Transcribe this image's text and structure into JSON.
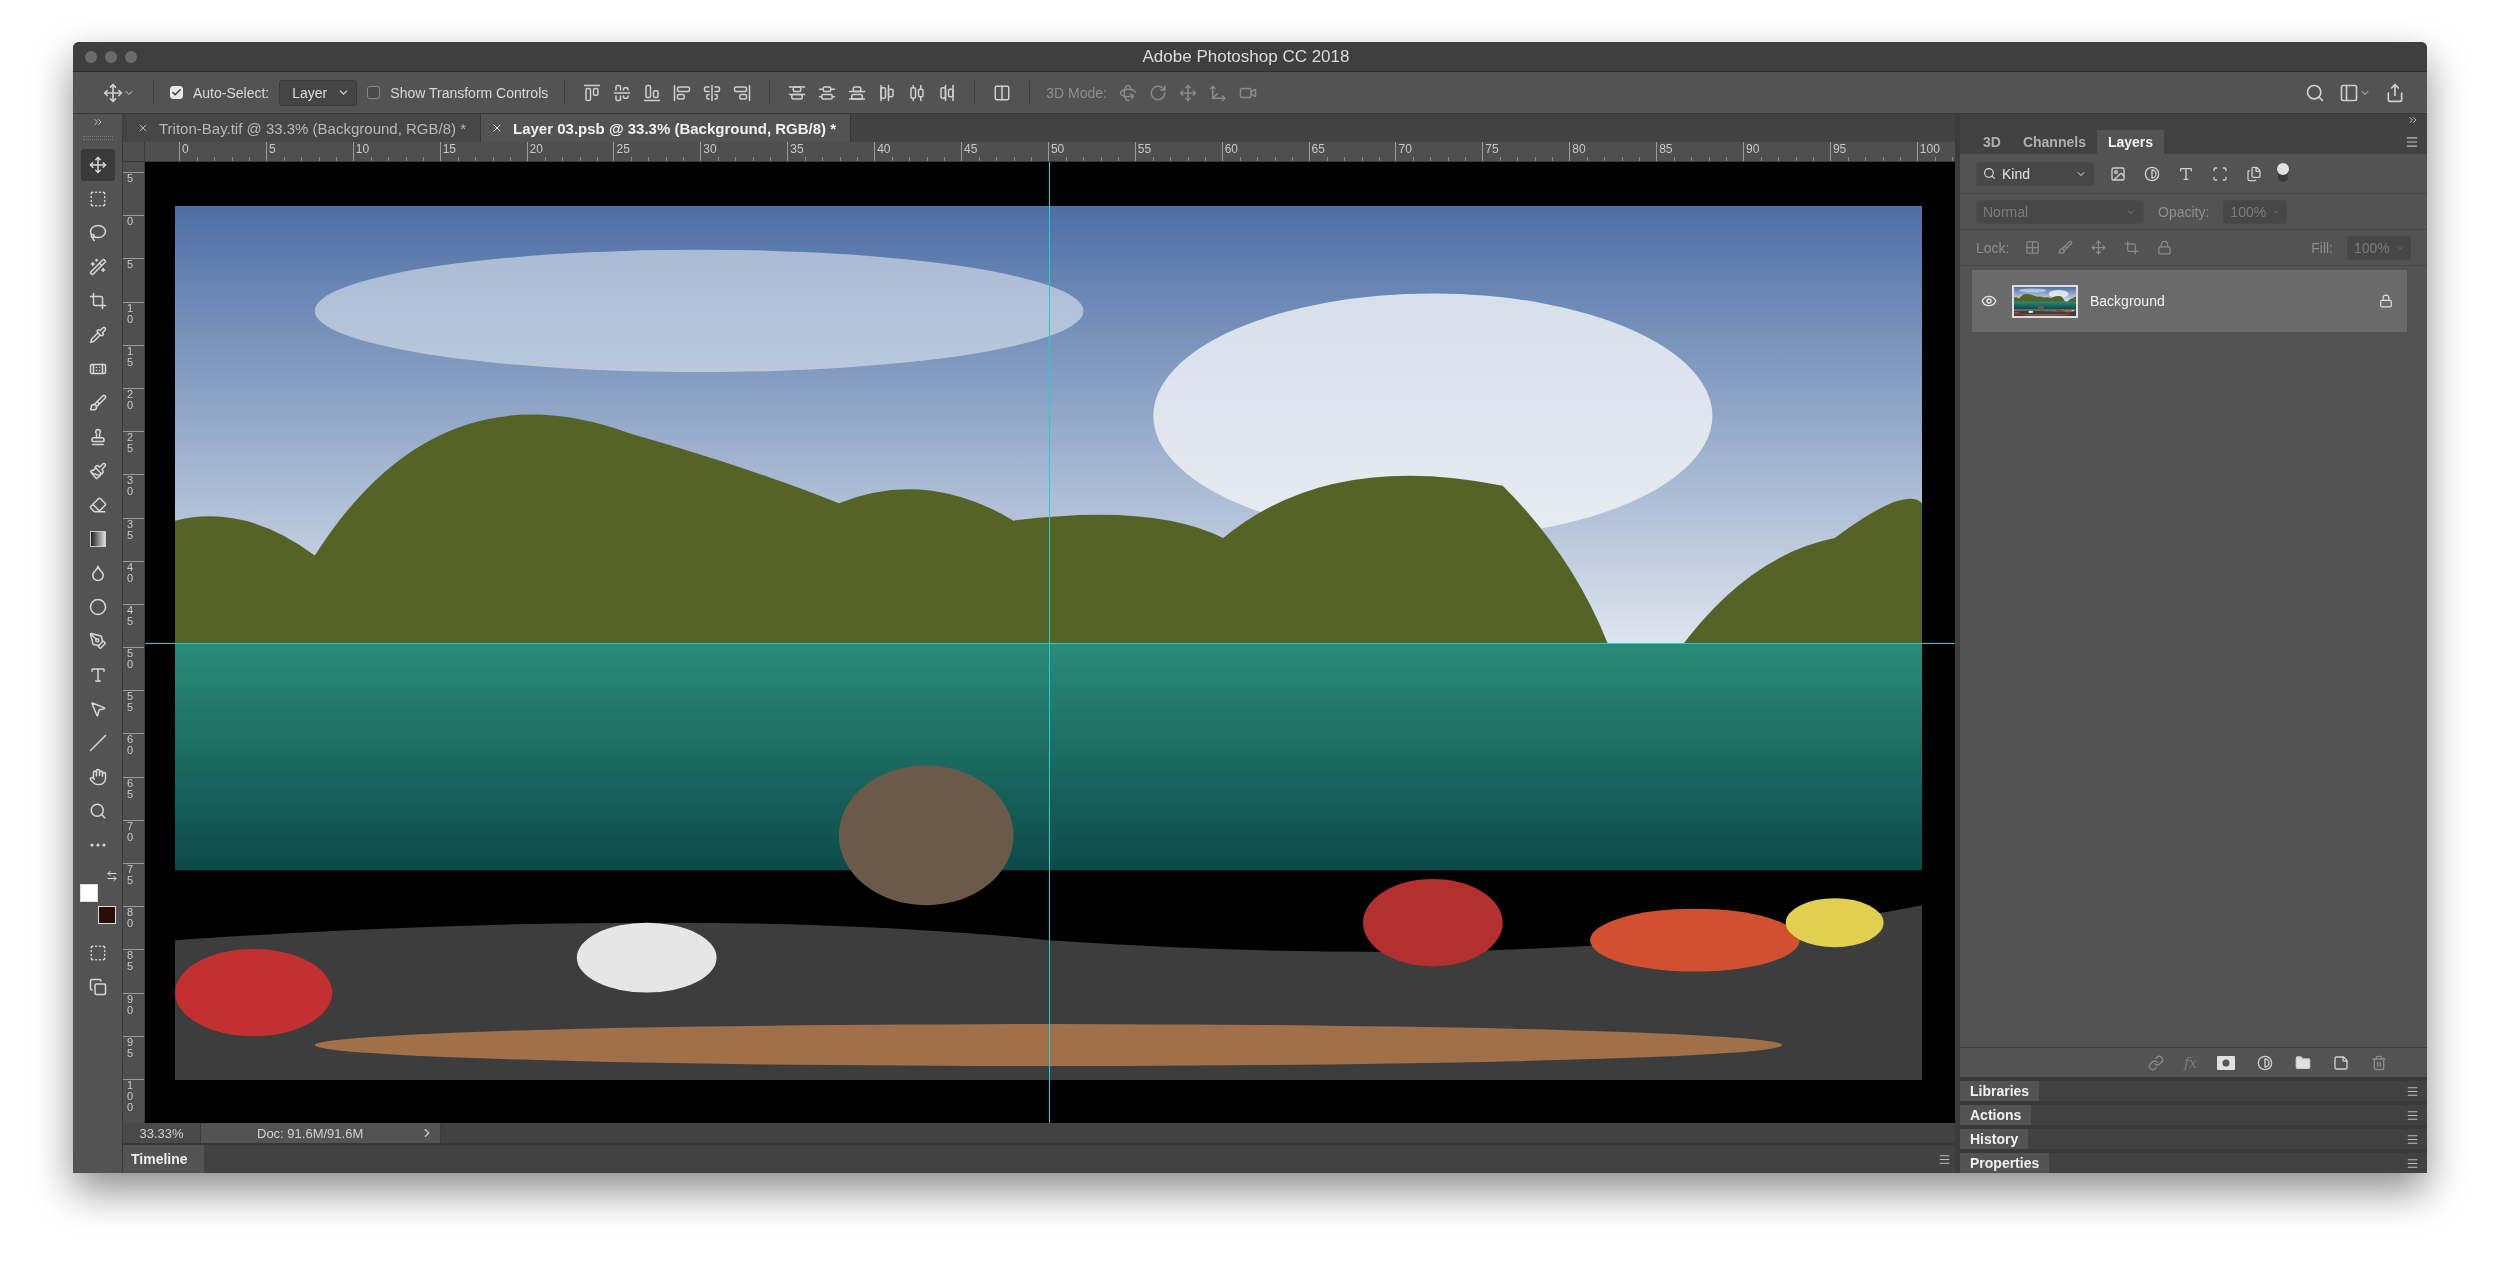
{
  "window": {
    "title": "Adobe Photoshop CC 2018"
  },
  "options_bar": {
    "auto_select": {
      "label": "Auto-Select:",
      "checked": true
    },
    "auto_select_target": "Layer",
    "transform_controls": {
      "label": "Show Transform Controls",
      "checked": false
    },
    "mode_label": "3D Mode:"
  },
  "document_tabs": [
    {
      "label": "Triton-Bay.tif @ 33.3% (Background, RGB/8) *",
      "selected": false
    },
    {
      "label": "Layer 03.psb @ 33.3% (Background, RGB/8) *",
      "selected": true
    }
  ],
  "rulers": {
    "horizontal": [
      "0",
      "5",
      "10",
      "15",
      "20",
      "25",
      "30",
      "35",
      "40",
      "45",
      "50",
      "55",
      "60",
      "65",
      "70",
      "75",
      "80",
      "85",
      "90",
      "95",
      "100"
    ],
    "vertical": [
      "5",
      "0",
      "5",
      "10",
      "15",
      "20",
      "25",
      "30",
      "35",
      "40",
      "45",
      "50",
      "55",
      "60",
      "65",
      "70",
      "75",
      "80",
      "85",
      "90",
      "95",
      "100"
    ]
  },
  "tools": [
    {
      "kind": "move",
      "selected": true
    },
    {
      "kind": "marquee",
      "selected": false
    },
    {
      "kind": "lasso",
      "selected": false
    },
    {
      "kind": "quickselect",
      "selected": false
    },
    {
      "kind": "crop",
      "selected": false
    },
    {
      "kind": "eyedropper",
      "selected": false
    },
    {
      "kind": "healing",
      "selected": false
    },
    {
      "kind": "brush",
      "selected": false
    },
    {
      "kind": "stamp",
      "selected": false
    },
    {
      "kind": "historybrush",
      "selected": false
    },
    {
      "kind": "eraser",
      "selected": false
    },
    {
      "kind": "gradient",
      "selected": false
    },
    {
      "kind": "blur",
      "selected": false
    },
    {
      "kind": "dodge",
      "selected": false
    },
    {
      "kind": "pen",
      "selected": false
    },
    {
      "kind": "type",
      "selected": false
    },
    {
      "kind": "pathselect",
      "selected": false
    },
    {
      "kind": "line",
      "selected": false
    },
    {
      "kind": "hand",
      "selected": false
    },
    {
      "kind": "zoom",
      "selected": false
    },
    {
      "kind": "more",
      "selected": false
    }
  ],
  "swatches": [
    {
      "color": "#ffffff"
    },
    {
      "color": "#2a0c08"
    }
  ],
  "status_bar": {
    "zoom": "33.33%",
    "doc_info": "Doc: 91.6M/91.6M"
  },
  "timeline": {
    "label": "Timeline"
  },
  "layers_panel": {
    "tabs": [
      {
        "label": "3D",
        "selected": false
      },
      {
        "label": "Channels",
        "selected": false
      },
      {
        "label": "Layers",
        "selected": true
      }
    ],
    "filter": {
      "value": "Kind"
    },
    "blend_mode": {
      "value": "Normal",
      "disabled": true
    },
    "opacity": {
      "label": "Opacity:",
      "value": "100%",
      "disabled": true
    },
    "lock_label": "Lock:",
    "fill": {
      "label": "Fill:",
      "value": "100%",
      "disabled": true
    },
    "layers": [
      {
        "name": "Background",
        "visible": true,
        "locked": true,
        "selected": true
      }
    ],
    "effects_label": "fx"
  },
  "collapsed_panels": [
    {
      "label": "Libraries"
    },
    {
      "label": "Actions"
    },
    {
      "label": "History"
    },
    {
      "label": "Properties"
    }
  ]
}
